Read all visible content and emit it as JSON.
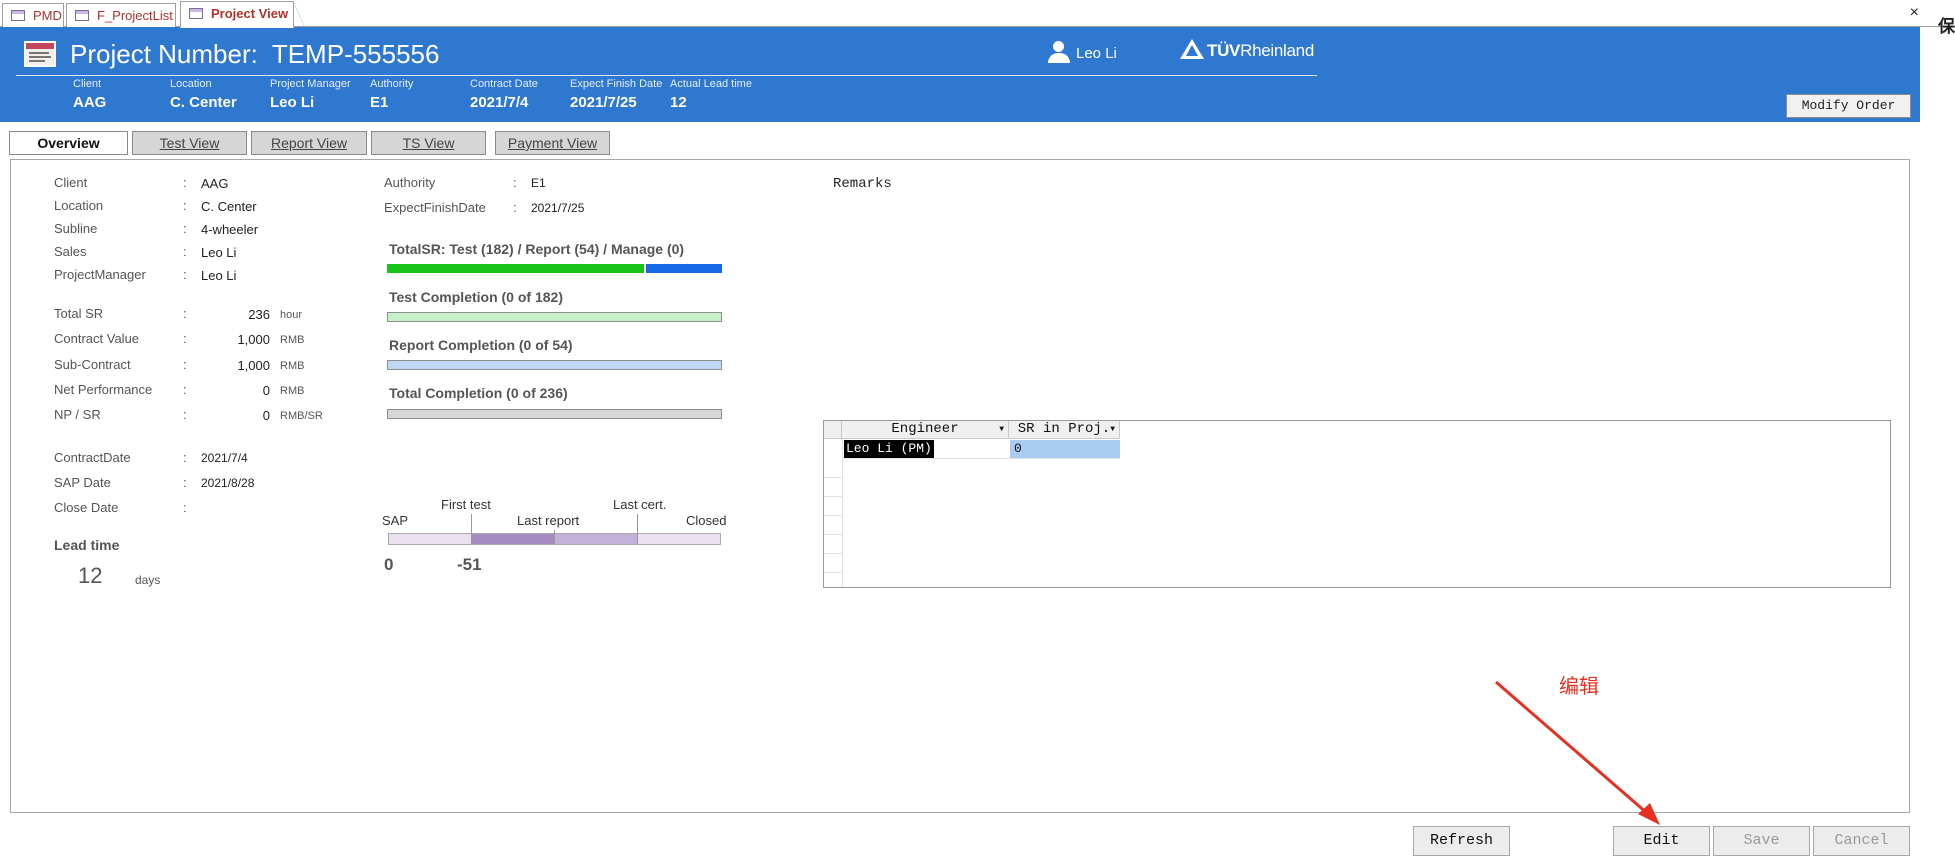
{
  "doc_tabs": [
    {
      "label": "PMD",
      "active": false
    },
    {
      "label": "F_ProjectList",
      "active": false
    },
    {
      "label": "Project View",
      "active": true
    }
  ],
  "window": {
    "close_glyph": "×",
    "edge_char": "保"
  },
  "header": {
    "icon": "form-icon",
    "title_prefix": "Project Number:",
    "project_number": "TEMP-555556",
    "user_name": "Leo Li",
    "logo_text_bold": "TÜV",
    "logo_text": "Rheinland",
    "meta": [
      {
        "label": "Client",
        "value": "AAG"
      },
      {
        "label": "Location",
        "value": "C. Center"
      },
      {
        "label": "Project Manager",
        "value": "Leo Li"
      },
      {
        "label": "Authority",
        "value": "E1"
      },
      {
        "label": "Contract Date",
        "value": "2021/7/4"
      },
      {
        "label": "Expect Finish Date",
        "value": "2021/7/25"
      },
      {
        "label": "Actual Lead time",
        "value": "12"
      }
    ],
    "modify_button": "Modify Order",
    "bg_color": "#2f78cf"
  },
  "nav_tabs": [
    "Overview",
    "Test View",
    "Report View",
    "TS View",
    "Payment View"
  ],
  "overview": {
    "info": [
      {
        "label": "Client",
        "value": "AAG"
      },
      {
        "label": "Location",
        "value": "C. Center"
      },
      {
        "label": "Subline",
        "value": "4-wheeler"
      },
      {
        "label": "Sales",
        "value": "Leo Li"
      },
      {
        "label": "ProjectManager",
        "value": "Leo Li"
      }
    ],
    "finance": [
      {
        "label": "Total SR",
        "value": "236",
        "unit": "hour"
      },
      {
        "label": "Contract Value",
        "value": "1,000",
        "unit": "RMB"
      },
      {
        "label": "Sub-Contract",
        "value": "1,000",
        "unit": "RMB"
      },
      {
        "label": "Net Performance",
        "value": "0",
        "unit": "RMB"
      },
      {
        "label": "NP / SR",
        "value": "0",
        "unit": "RMB/SR"
      }
    ],
    "dates": [
      {
        "label": "ContractDate",
        "value": "2021/7/4"
      },
      {
        "label": "SAP Date",
        "value": "2021/8/28"
      },
      {
        "label": "Close Date",
        "value": ""
      }
    ],
    "lead_time_label": "Lead time",
    "lead_time_value": "12",
    "lead_time_unit": "days",
    "authority_label": "Authority",
    "authority_value": "E1",
    "expect_finish_label": "ExpectFinishDate",
    "expect_finish_value": "2021/7/25",
    "colon": ":",
    "progress": [
      {
        "label": "TotalSR: Test (182) / Report (54) / Manage (0)",
        "segments": [
          {
            "fraction": 0.772,
            "color": "#19c319"
          },
          {
            "fraction": 0.228,
            "color": "#1767e6"
          }
        ]
      },
      {
        "label": "Test Completion (0 of 182)",
        "fraction": 0,
        "track_color": "#c8f0c8"
      },
      {
        "label": "Report Completion (0 of 54)",
        "fraction": 0,
        "track_color": "#bcd8f5"
      },
      {
        "label": "Total Completion (0 of 236)",
        "fraction": 0,
        "track_color": "#d6d6d6"
      }
    ],
    "timeline": {
      "labels_top": [
        "First test",
        "Last cert."
      ],
      "labels_mid": [
        "SAP",
        "Last report",
        "Closed"
      ],
      "values": [
        "0",
        "-51"
      ]
    },
    "remarks_label": "Remarks"
  },
  "engineer_grid": {
    "columns": [
      "Engineer",
      "SR in Proj."
    ],
    "rows": [
      [
        "Leo Li (PM)",
        "0"
      ]
    ]
  },
  "annotation": {
    "text": "编辑",
    "color": "#e53022"
  },
  "buttons": [
    {
      "label": "Refresh",
      "enabled": true
    },
    {
      "label": "Edit",
      "enabled": true
    },
    {
      "label": "Save",
      "enabled": false
    },
    {
      "label": "Cancel",
      "enabled": false
    }
  ]
}
